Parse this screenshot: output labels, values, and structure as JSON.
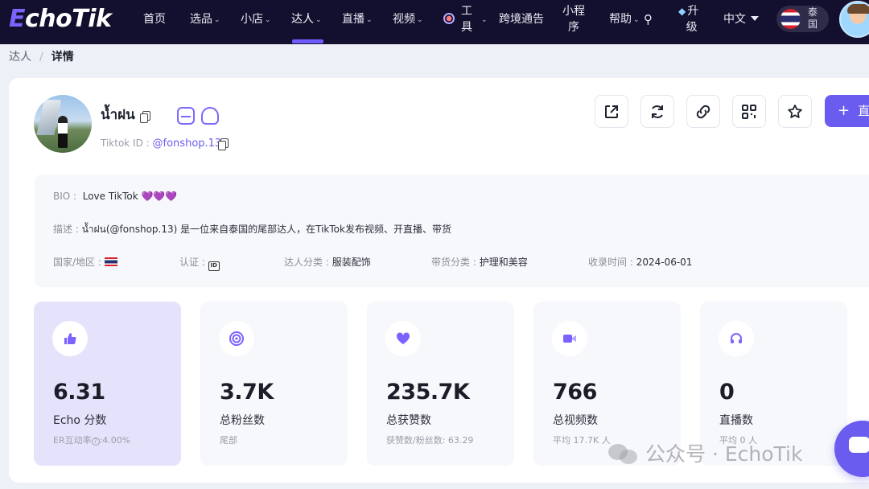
{
  "nav": {
    "logo_e": "E",
    "logo_rest": "choTik",
    "items": [
      {
        "label": "首页"
      },
      {
        "label": "选品"
      },
      {
        "label": "小店"
      },
      {
        "label": "达人"
      },
      {
        "label": "直播"
      },
      {
        "label": "视频"
      },
      {
        "label_top": "工",
        "label_bottom": "具"
      },
      {
        "label": "跨境通告"
      },
      {
        "label_top": "小程",
        "label_bottom": "序"
      },
      {
        "label": "帮助"
      },
      {
        "label_top": "升",
        "label_bottom": "级"
      }
    ],
    "language": "中文",
    "region_top": "泰",
    "region_bottom": "国",
    "active_item": "达人"
  },
  "breadcrumb": {
    "parent": "达人",
    "separator": "/",
    "current": "详情"
  },
  "profile": {
    "name": "น้ำฝน",
    "tiktok_id_label": "Tiktok ID :",
    "tiktok_id": "@fonshop.13"
  },
  "actions": {
    "primary_label": "直"
  },
  "info": {
    "bio_label": "BIO :",
    "bio": "Love TikTok 💜💜💜",
    "desc_label": "描述 :",
    "desc": "น้ำฝน(@fonshop.13) 是一位来自泰国的尾部达人，在TikTok发布视频、开直播、带货",
    "country_label": "国家/地区 :",
    "verify_label": "认证 :",
    "category_label": "达人分类 :",
    "category": "服装配饰",
    "goods_label": "带货分类 :",
    "goods": "护理和美容",
    "time_label": "收录时间 :",
    "time": "2024-06-01"
  },
  "stats": [
    {
      "value": "6.31",
      "label": "Echo 分数",
      "sub": "ER互动率",
      "sub2": ":4.00%",
      "icon": "thumbs-up-icon"
    },
    {
      "value": "3.7K",
      "label": "总粉丝数",
      "sub": "尾部",
      "icon": "target-icon"
    },
    {
      "value": "235.7K",
      "label": "总获赞数",
      "sub": "获赞数/粉丝数: 63.29",
      "icon": "heart-icon"
    },
    {
      "value": "766",
      "label": "总视频数",
      "sub": "平均 17.7K 人",
      "icon": "video-icon"
    },
    {
      "value": "0",
      "label": "直播数",
      "sub": "平均 0 人",
      "icon": "headset-icon"
    }
  ],
  "watermark": "公众号 · EchoTik",
  "colors": {
    "nav_bg": "#12102e",
    "accent": "#6b5cf0",
    "active_card": "#e5e3fb"
  }
}
